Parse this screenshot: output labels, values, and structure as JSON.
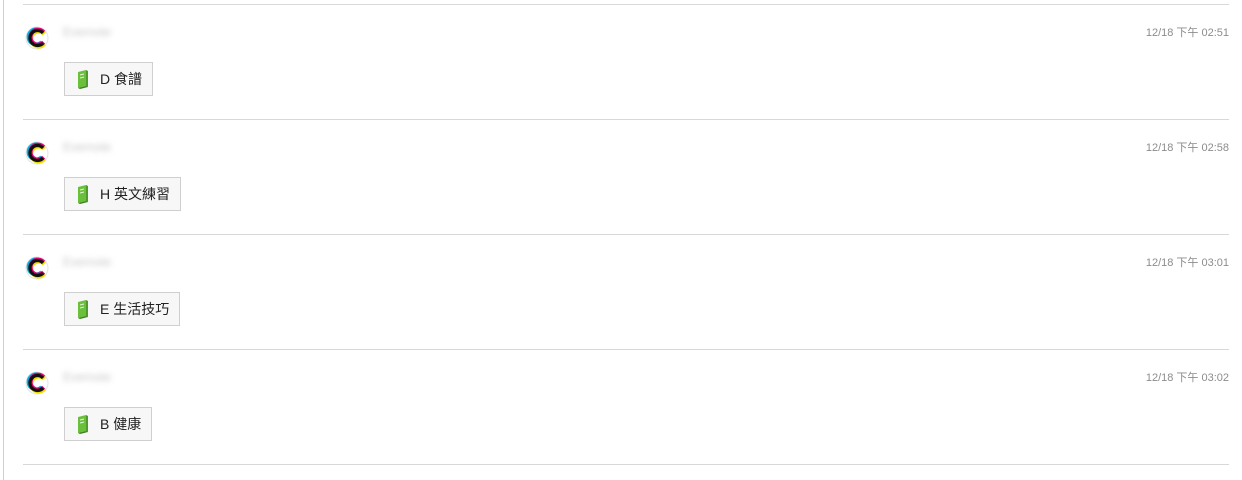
{
  "entries": [
    {
      "author": "Evernote",
      "timestamp": "12/18 下午 02:51",
      "notebook": {
        "label": "D 食譜",
        "icon": "notebook-icon"
      }
    },
    {
      "author": "Evernote",
      "timestamp": "12/18 下午 02:58",
      "notebook": {
        "label": "H 英文練習",
        "icon": "notebook-icon"
      }
    },
    {
      "author": "Evernote",
      "timestamp": "12/18 下午 03:01",
      "notebook": {
        "label": "E 生活技巧",
        "icon": "notebook-icon"
      }
    },
    {
      "author": "Evernote",
      "timestamp": "12/18 下午 03:02",
      "notebook": {
        "label": "B 健康",
        "icon": "notebook-icon"
      }
    }
  ],
  "colors": {
    "notebook_green": "#6abf3b",
    "divider": "#d8d8d8",
    "timestamp_text": "#8c8c8c"
  }
}
